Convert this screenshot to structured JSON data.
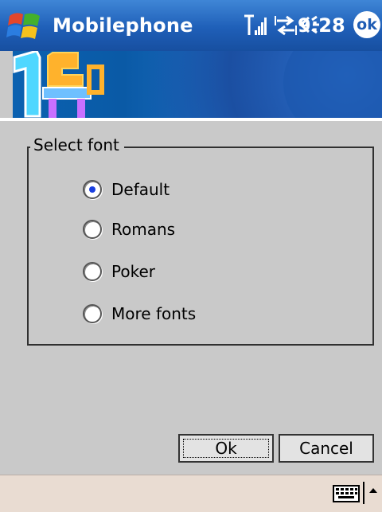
{
  "titlebar": {
    "app_title": "Mobilephone",
    "time": "9:28",
    "ok_label": "ok",
    "icons": [
      "windows-start-icon",
      "signal-strength-icon",
      "connectivity-icon",
      "volume-icon"
    ]
  },
  "dialog": {
    "group_label": "Select font",
    "options": [
      {
        "label": "Default",
        "selected": true
      },
      {
        "label": "Romans",
        "selected": false
      },
      {
        "label": "Poker",
        "selected": false
      },
      {
        "label": "More fonts",
        "selected": false
      }
    ]
  },
  "buttons": {
    "ok_label": "Ok",
    "cancel_label": "Cancel"
  },
  "bottombar": {
    "icons": [
      "keyboard-icon",
      "up-arrow-icon"
    ]
  },
  "colors": {
    "titlebar_blue": "#1f5fb8",
    "background": "#c9c9c9",
    "bottombar": "#e9dcd2",
    "radio_dot": "#1a3fe0"
  }
}
